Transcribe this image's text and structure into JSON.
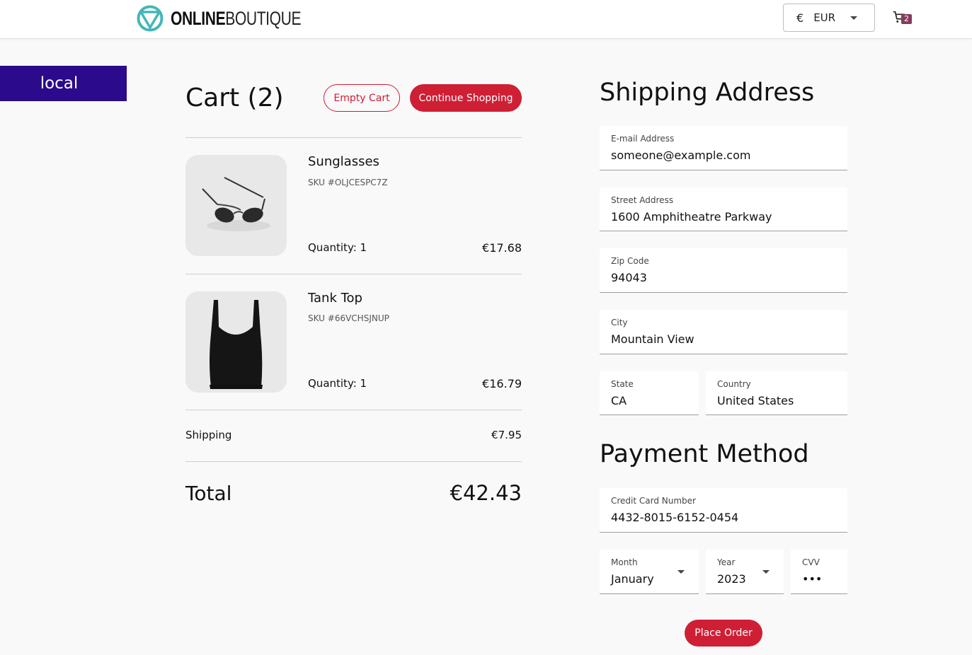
{
  "header": {
    "logo_bold": "ONLINE",
    "logo_light": "BOUTIQUE",
    "currency_symbol": "€",
    "currency_code": "EUR",
    "cart_count": "2",
    "brand_color": "#45b6b8"
  },
  "env_banner": {
    "label": "local",
    "color": "#2b0a8c"
  },
  "cart": {
    "title": "Cart (2)",
    "empty_label": "Empty Cart",
    "continue_label": "Continue Shopping",
    "items": [
      {
        "name": "Sunglasses",
        "sku": "SKU #OLJCESPC7Z",
        "quantity": "Quantity: 1",
        "price": "€17.68",
        "icon": "sunglasses-image"
      },
      {
        "name": "Tank Top",
        "sku": "SKU #66VCHSJNUP",
        "quantity": "Quantity: 1",
        "price": "€16.79",
        "icon": "tank-top-image"
      }
    ],
    "shipping_label": "Shipping",
    "shipping_value": "€7.95",
    "total_label": "Total",
    "total_value": "€42.43"
  },
  "shipping": {
    "title": "Shipping Address",
    "email": {
      "label": "E-mail Address",
      "value": "someone@example.com"
    },
    "street": {
      "label": "Street Address",
      "value": "1600 Amphitheatre Parkway"
    },
    "zip": {
      "label": "Zip Code",
      "value": "94043"
    },
    "city": {
      "label": "City",
      "value": "Mountain View"
    },
    "state": {
      "label": "State",
      "value": "CA"
    },
    "country": {
      "label": "Country",
      "value": "United States"
    }
  },
  "payment": {
    "title": "Payment Method",
    "card": {
      "label": "Credit Card Number",
      "value": "4432-8015-6152-0454"
    },
    "month": {
      "label": "Month",
      "value": "January"
    },
    "year": {
      "label": "Year",
      "value": "2023"
    },
    "cvv": {
      "label": "CVV",
      "value": "•••"
    },
    "place_order_label": "Place Order"
  },
  "accent_color": "#cf1f35"
}
